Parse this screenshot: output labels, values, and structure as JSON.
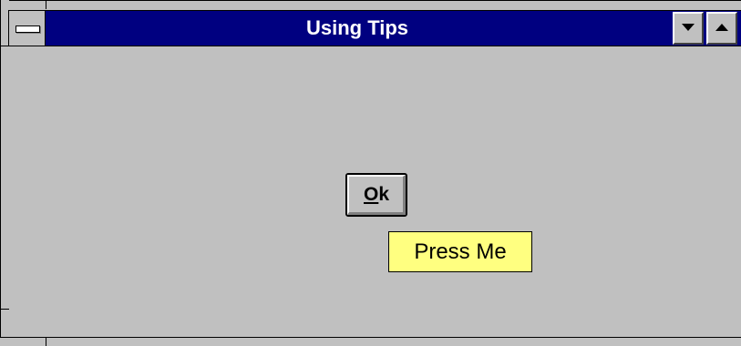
{
  "window": {
    "title": "Using Tips"
  },
  "dialog": {
    "ok_label_accel": "O",
    "ok_label_rest": "k",
    "tooltip": "Press Me"
  },
  "icons": {
    "system_menu": "system-menu-icon",
    "minimize": "minimize-arrow-icon",
    "maximize": "maximize-arrow-icon"
  },
  "colors": {
    "titlebar": "#000080",
    "face": "#c0c0c0",
    "tooltip_bg": "#ffff80"
  }
}
